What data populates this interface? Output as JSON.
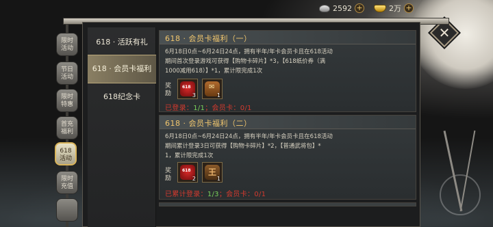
{
  "currency": {
    "silver": "2592",
    "gold": "2万"
  },
  "tabs": [
    {
      "label": "限时\n活动",
      "active": false
    },
    {
      "label": "节日\n活动",
      "active": false
    },
    {
      "label": "限时\n特惠",
      "active": false
    },
    {
      "label": "首充\n福利",
      "active": false
    },
    {
      "label": "618\n活动",
      "active": true
    },
    {
      "label": "限时\n充值",
      "active": false
    },
    {
      "label": "",
      "active": false
    }
  ],
  "categories": [
    {
      "label": "618 · 活跃有礼",
      "active": false
    },
    {
      "label": "618 · 会员卡福利",
      "active": true
    },
    {
      "label": "618纪念卡",
      "active": false
    }
  ],
  "cards": [
    {
      "title": "618 · 会员卡福利（一）",
      "desc_lines": [
        "6月18日0点~6月24日24点，拥有半年/年卡会员卡且在618活动",
        "期间首次登录游戏可获得【购物卡碎片】*3，【618纸价券（满",
        "1000减用618）】*1，累计限完成1次"
      ],
      "reward_label": "奖励",
      "rewards": [
        {
          "icon": "ticket-618-icon",
          "badge": "618",
          "count": "3"
        },
        {
          "icon": "scroll-coupon-icon",
          "badge": "",
          "count": "1"
        }
      ],
      "progress_prefix": "已登录：",
      "progress_value": "1/1",
      "progress_suffix": "；会员卡：0/1"
    },
    {
      "title": "618 · 会员卡福利（二）",
      "desc_lines": [
        "6月18日0点~6月24日24点，拥有半年/年卡会员卡且在618活动",
        "期间累计登录3日可获得【购物卡碎片】*2，【普通武将包】*",
        "1，累计限完成1次"
      ],
      "reward_label": "奖励",
      "rewards": [
        {
          "icon": "ticket-618-icon",
          "badge": "618",
          "count": "2"
        },
        {
          "icon": "general-token-icon",
          "badge": "",
          "count": "1"
        }
      ],
      "progress_prefix": "已累计登录：",
      "progress_value": "1/3",
      "progress_suffix": "；会员卡：0/1"
    }
  ],
  "close_label": "✕"
}
